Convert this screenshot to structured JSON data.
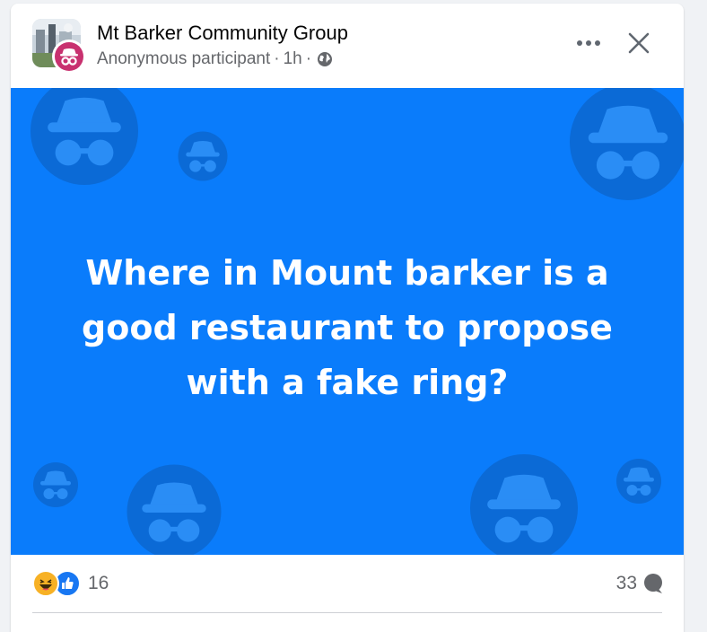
{
  "post": {
    "group_name": "Mt Barker Community Group",
    "author": "Anonymous participant",
    "separator": "·",
    "time": "1h",
    "audience_icon": "globe-icon",
    "text": "Where in Mount barker is a good restaurant to propose with a fake ring?",
    "background_color": "#0a7cfb"
  },
  "footer": {
    "reaction_icons": [
      "haha-icon",
      "like-icon"
    ],
    "reaction_count": "16",
    "comment_count": "33",
    "comment_icon": "comment-icon"
  },
  "actions": {
    "more_icon": "more-options-icon",
    "close_icon": "close-icon"
  }
}
